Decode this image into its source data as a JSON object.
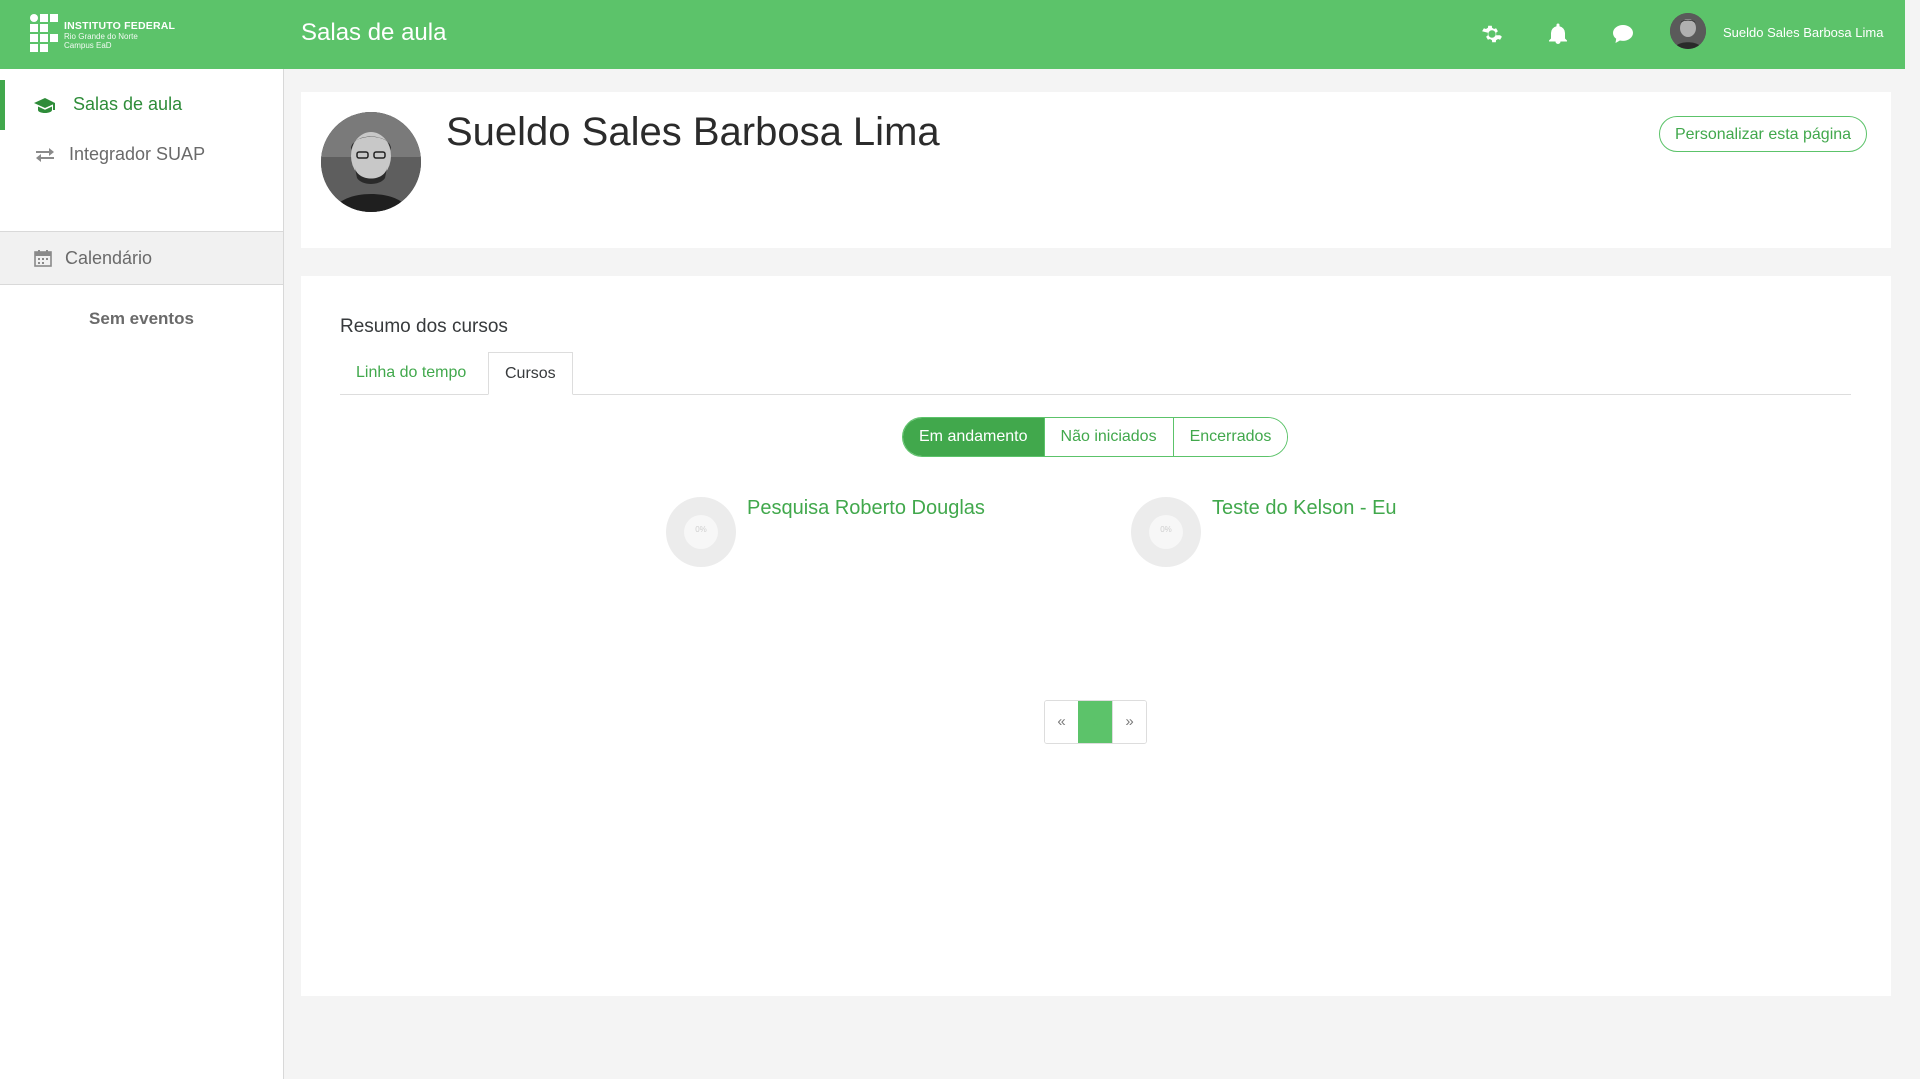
{
  "colors": {
    "brand_green": "#5cc36a",
    "accent_green": "#41a84c",
    "page_background": "#f4f4f4"
  },
  "header": {
    "logo": {
      "line1": "INSTITUTO FEDERAL",
      "line2": "Rio Grande do Norte",
      "line3": "Campus EaD"
    },
    "page_title": "Salas de aula",
    "icons": [
      "gear-icon",
      "bell-icon",
      "chat-bubble-icon"
    ],
    "user_name": "Sueldo Sales Barbosa Lima"
  },
  "sidebar": {
    "items": [
      {
        "label": "Salas de aula",
        "icon": "graduation-cap-icon",
        "active": true
      },
      {
        "label": "Integrador SUAP",
        "icon": "exchange-arrows-icon",
        "active": false
      }
    ],
    "calendar": {
      "label": "Calendário",
      "icon": "calendar-icon",
      "empty_text": "Sem eventos"
    }
  },
  "profile": {
    "name": "Sueldo Sales Barbosa Lima",
    "customize_button": "Personalizar esta página"
  },
  "course_overview": {
    "title": "Resumo dos cursos",
    "tabs": [
      {
        "label": "Linha do tempo",
        "selected": false
      },
      {
        "label": "Cursos",
        "selected": true
      }
    ],
    "filters": [
      {
        "label": "Em andamento",
        "selected": true
      },
      {
        "label": "Não iniciados",
        "selected": false
      },
      {
        "label": "Encerrados",
        "selected": false
      }
    ],
    "courses": [
      {
        "name": "Pesquisa Roberto Douglas",
        "progress_label": "0%"
      },
      {
        "name": "Teste do Kelson - Eu",
        "progress_label": "0%"
      }
    ],
    "pagination": {
      "prev": "«",
      "current": "1",
      "next": "»"
    }
  }
}
